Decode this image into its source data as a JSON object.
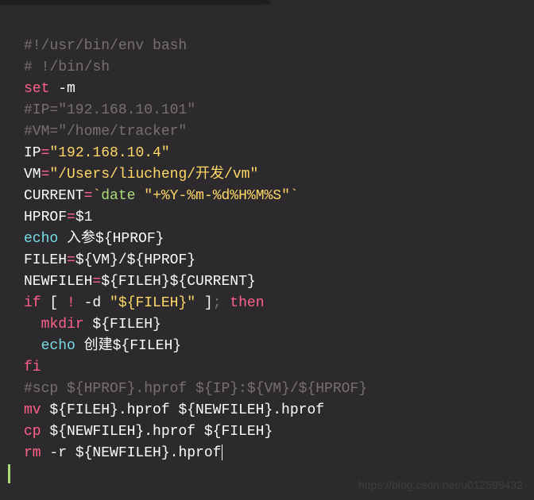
{
  "lines": {
    "l1": "#!/usr/bin/env bash",
    "l2": "# !/bin/sh",
    "l3_set": "set",
    "l3_rest": " -m",
    "l4": "#IP=\"192.168.10.101\"",
    "l5": "#VM=\"/home/tracker\"",
    "l6_var": "IP",
    "l6_eq": "=",
    "l6_str": "\"192.168.10.4\"",
    "l7_var": "VM",
    "l7_eq": "=",
    "l7_str": "\"/Users/liucheng/开发/vm\"",
    "l8_var": "CURRENT",
    "l8_eq": "=",
    "l8_tick1": "`",
    "l8_fn": "date",
    "l8_sp": " ",
    "l8_str": "\"+%Y-%m-%d%H%M%S\"",
    "l8_tick2": "`",
    "l9_var": "HPROF",
    "l9_eq": "=",
    "l9_val": "$1",
    "l10_echo": "echo",
    "l10_rest": " 入参${HPROF}",
    "l11_var": "FILEH",
    "l11_eq": "=",
    "l11_val": "${VM}/${HPROF}",
    "l12_var": "NEWFILEH",
    "l12_eq": "=",
    "l12_val": "${FILEH}${CURRENT}",
    "l13_if": "if",
    "l13_b1": " [ ",
    "l13_neg": "!",
    "l13_d": " -d ",
    "l13_str": "\"${FILEH}\"",
    "l13_b2": " ]",
    "l13_semi": "; ",
    "l13_then": "then",
    "l14_ind": "  ",
    "l14_mkdir": "mkdir",
    "l14_rest": " ${FILEH}",
    "l15_ind": "  ",
    "l15_echo": "echo",
    "l15_rest": " 创建${FILEH}",
    "l16_fi": "fi",
    "l17": "#scp ${HPROF}.hprof ${IP}:${VM}/${HPROF}",
    "l18_mv": "mv",
    "l18_rest": " ${FILEH}.hprof ${NEWFILEH}.hprof",
    "l19_cp": "cp",
    "l19_rest": " ${NEWFILEH}.hprof ${FILEH}",
    "l20_rm": "rm",
    "l20_rest": " -r ${NEWFILEH}.hprof"
  },
  "watermark": "https://blog.csdn.net/u012599432"
}
